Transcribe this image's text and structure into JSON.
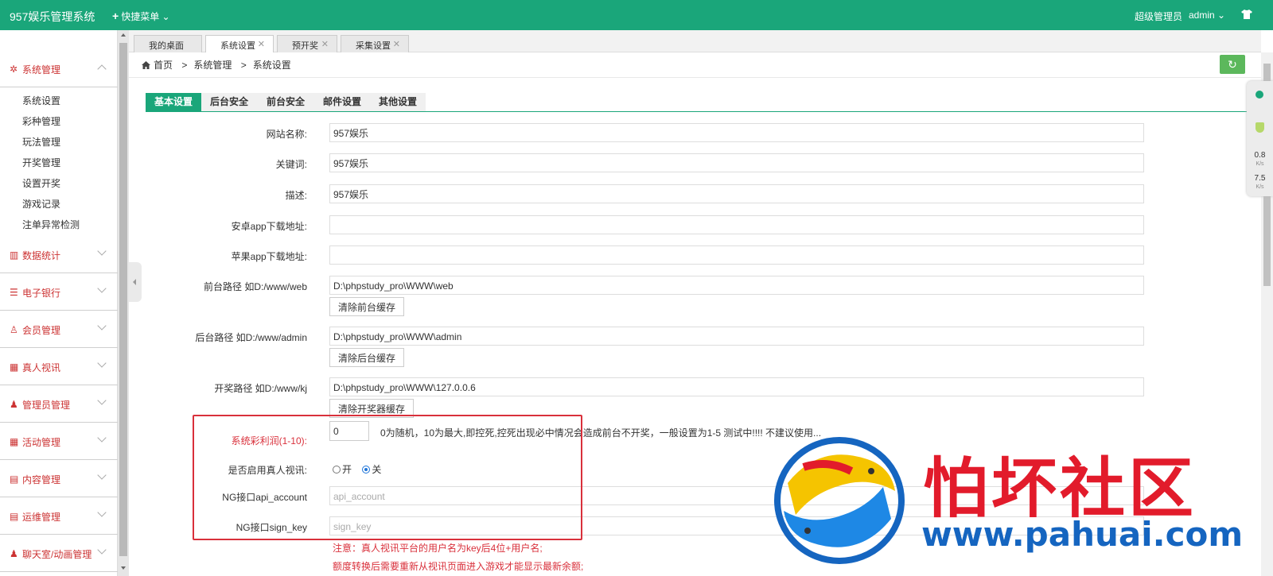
{
  "app": {
    "brand": "957娱乐管理系统",
    "quick_menu": "快捷菜单",
    "role": "超级管理员",
    "user": "admin"
  },
  "colors": {
    "primary": "#1aa67a",
    "danger": "#d9303b",
    "link_blue": "#1e74d8"
  },
  "sidebar": {
    "groups": [
      {
        "label": "系统管理",
        "icon": "gear-icon",
        "open": true,
        "items": [
          "系统设置",
          "彩种管理",
          "玩法管理",
          "开奖管理",
          "设置开奖",
          "游戏记录",
          "注单异常检测"
        ]
      },
      {
        "label": "数据统计",
        "icon": "chart-icon"
      },
      {
        "label": "电子银行",
        "icon": "list-icon"
      },
      {
        "label": "会员管理",
        "icon": "user-icon"
      },
      {
        "label": "真人视讯",
        "icon": "calendar-icon"
      },
      {
        "label": "管理员管理",
        "icon": "person-icon"
      },
      {
        "label": "活动管理",
        "icon": "calendar-icon"
      },
      {
        "label": "内容管理",
        "icon": "book-icon"
      },
      {
        "label": "运维管理",
        "icon": "book-icon"
      },
      {
        "label": "聊天室/动画管理",
        "icon": "person-icon"
      }
    ]
  },
  "tabs": [
    {
      "label": "我的桌面",
      "closable": false,
      "active": false
    },
    {
      "label": "系统设置",
      "closable": true,
      "active": true
    },
    {
      "label": "预开奖",
      "closable": true,
      "active": false
    },
    {
      "label": "采集设置",
      "closable": true,
      "active": false
    }
  ],
  "breadcrumb": [
    "首页",
    "系统管理",
    "系统设置"
  ],
  "breadcrumb_sep": ">",
  "subnav": [
    "基本设置",
    "后台安全",
    "前台安全",
    "邮件设置",
    "其他设置"
  ],
  "form": {
    "site_name": {
      "label": "网站名称:",
      "value": "957娱乐"
    },
    "keywords": {
      "label": "关键词:",
      "value": "957娱乐"
    },
    "description": {
      "label": "描述:",
      "value": "957娱乐"
    },
    "android_url": {
      "label": "安卓app下载地址:",
      "value": ""
    },
    "ios_url": {
      "label": "苹果app下载地址:",
      "value": ""
    },
    "front_path": {
      "label": "前台路径 如D:/www/web",
      "value": "D:\\phpstudy_pro\\WWW\\web",
      "button": "清除前台缓存"
    },
    "admin_path": {
      "label": "后台路径 如D:/www/admin",
      "value": "D:\\phpstudy_pro\\WWW\\admin",
      "button": "清除后台缓存"
    },
    "draw_path": {
      "label": "开奖路径 如D:/www/kj",
      "value": "D:\\phpstudy_pro\\WWW\\127.0.0.6",
      "button": "清除开奖器缓存"
    },
    "profit": {
      "label": "系统彩利润(1-10):",
      "value": "0",
      "hint": "0为随机，10为最大,即控死,控死出现必中情况会造成前台不开奖，一般设置为1-5 测试中!!!! 不建议使用..."
    },
    "live_video": {
      "label": "是否启用真人视讯:",
      "on_label": "开",
      "off_label": "关",
      "selected": "off"
    },
    "api_account": {
      "label": "NG接口api_account",
      "placeholder": "api_account"
    },
    "sign_key": {
      "label": "NG接口sign_key",
      "placeholder": "sign_key"
    },
    "note1": "注意：真人视讯平台的用户名为key后4位+用户名;",
    "note2": "额度转换后需要重新从视讯页面进入游戏才能显示最新余额;"
  },
  "netmon": {
    "up": "0.8",
    "down": "7.5",
    "unit": "K/s"
  },
  "watermark": {
    "cn": "怕坏社区",
    "url": "www.pahuai.com"
  }
}
